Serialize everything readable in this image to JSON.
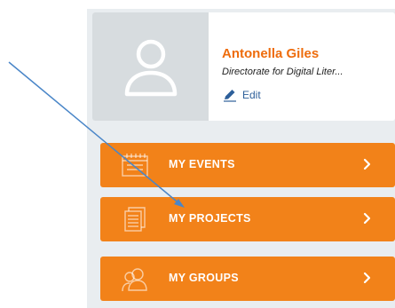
{
  "profile": {
    "name": "Antonella Giles",
    "organization": "Directorate for Digital Liter...",
    "edit_label": "Edit",
    "avatar_icon": "user-silhouette-icon"
  },
  "menu": {
    "items": [
      {
        "label": "MY EVENTS",
        "icon": "calendar-icon"
      },
      {
        "label": "MY PROJECTS",
        "icon": "document-icon"
      },
      {
        "label": "MY GROUPS",
        "icon": "group-icon"
      }
    ]
  },
  "colors": {
    "accent": "#f28219",
    "name_orange": "#ee6c0c",
    "link_blue": "#2d5f9a",
    "annotation_arrow": "#4a86c8",
    "sidebar_bg": "#e9edf0",
    "avatar_bg": "#d7dcdf"
  }
}
